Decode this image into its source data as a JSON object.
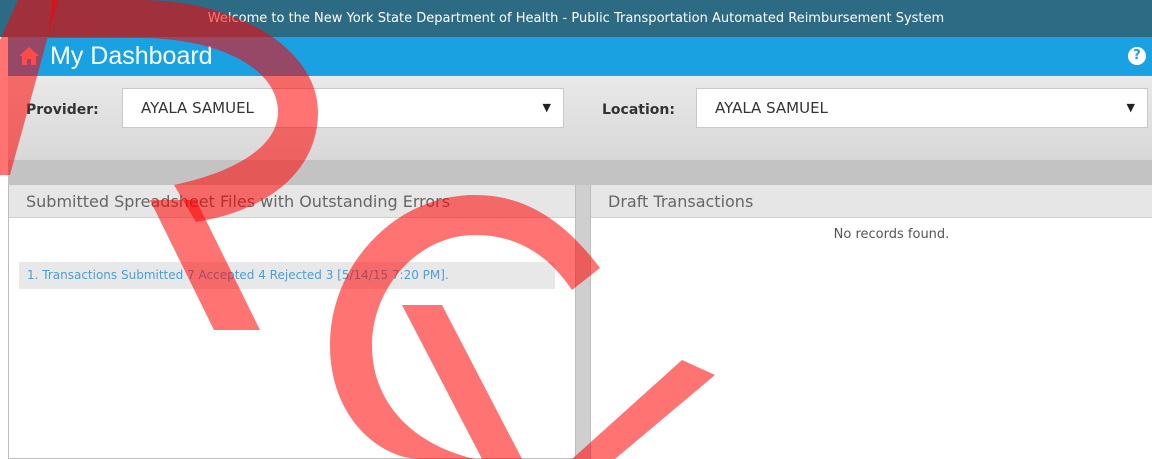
{
  "banner": {
    "text": "Welcome to the New York State Department of Health - Public Transportation Automated Reimbursement System"
  },
  "header": {
    "title": "My Dashboard",
    "home_icon": "home-icon",
    "help_icon": "question-circle-icon",
    "help_symbol": "?"
  },
  "filters": {
    "provider": {
      "label": "Provider:",
      "value": "AYALA SAMUEL"
    },
    "location": {
      "label": "Location:",
      "value": "AYALA SAMUEL"
    },
    "caret": "▼"
  },
  "panels": {
    "errors": {
      "title": "Submitted Spreadsheet Files with Outstanding Errors",
      "items": [
        "1. Transactions Submitted 7 Accepted 4 Rejected 3 [5/14/15 7:20 PM]."
      ]
    },
    "drafts": {
      "title": "Draft Transactions",
      "empty_text": "No records found."
    }
  },
  "colors": {
    "banner": "#2d6a83",
    "accent": "#1aa1e2",
    "link": "#4a9fd6",
    "watermark": "#ff0000"
  }
}
